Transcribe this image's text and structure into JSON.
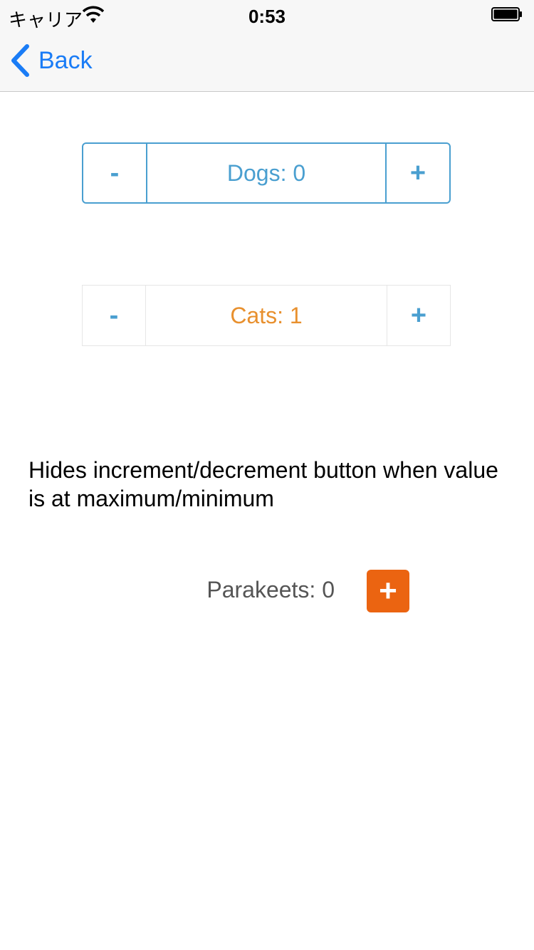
{
  "status_bar": {
    "carrier": "キャリア",
    "time": "0:53"
  },
  "nav": {
    "back_label": "Back"
  },
  "dogs_stepper": {
    "decrement": "-",
    "increment": "+",
    "label": "Dogs: 0"
  },
  "cats_stepper": {
    "decrement": "-",
    "increment": "+",
    "label": "Cats: 1"
  },
  "description": "Hides increment/decrement button when value is at maximum/minimum",
  "parakeets": {
    "label": "Parakeets: 0",
    "increment": "+"
  },
  "colors": {
    "accent_blue": "#4a9fd0",
    "cats_orange": "#e8902e",
    "button_orange": "#eb6411",
    "ios_blue": "#1a7cf6"
  }
}
